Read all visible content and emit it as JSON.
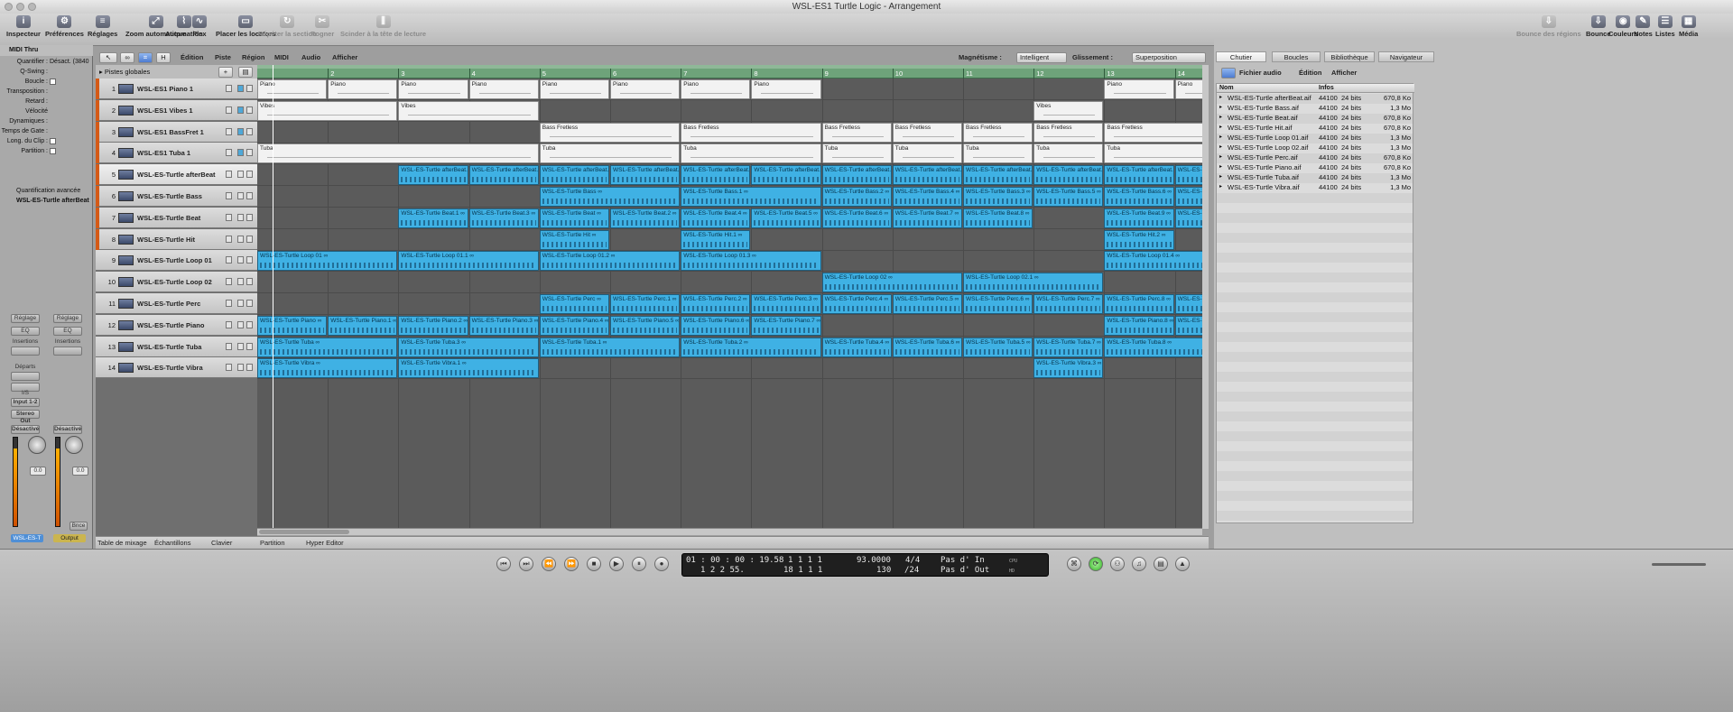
{
  "window": {
    "title": "WSL-ES1 Turtle Logic - Arrangement"
  },
  "toolbar": {
    "left": [
      {
        "label": "Inspecteur",
        "icon": "i"
      },
      {
        "label": "Préférences",
        "icon": "⚙"
      },
      {
        "label": "Réglages",
        "icon": "≡"
      },
      {
        "label": "Zoom automatique",
        "icon": "⤢"
      },
      {
        "label": "Automation",
        "icon": "⌇"
      },
      {
        "label": "Flex",
        "icon": "∿"
      },
      {
        "label": "Placer les locators",
        "icon": "▭"
      },
      {
        "label": "Répéter la section",
        "icon": "↻"
      },
      {
        "label": "Rogner",
        "icon": "✂"
      },
      {
        "label": "Scinder à la tête de lecture",
        "icon": "⫼"
      }
    ],
    "right": [
      {
        "label": "Bounce des régions",
        "icon": "⇩"
      },
      {
        "label": "Bounce",
        "icon": "⇩"
      },
      {
        "label": "Couleurs",
        "icon": "◉"
      },
      {
        "label": "Notes",
        "icon": "✎"
      },
      {
        "label": "Listes",
        "icon": "☰"
      },
      {
        "label": "Média",
        "icon": "▦"
      }
    ]
  },
  "inspector": {
    "header": "MIDI Thru",
    "rows": [
      {
        "label": "Quantifier :",
        "value": "Désact. (3840"
      },
      {
        "label": "Q-Swing :",
        "value": ""
      },
      {
        "label": "Boucle :",
        "value": ""
      },
      {
        "label": "Transposition :",
        "value": ""
      },
      {
        "label": "Retard :",
        "value": ""
      },
      {
        "label": "Vélocité",
        "value": ""
      },
      {
        "label": "Dynamiques :",
        "value": ""
      },
      {
        "label": "Temps de Gate :",
        "value": ""
      },
      {
        "label": "Long. du Clip :",
        "value": ""
      },
      {
        "label": "Partition :",
        "value": ""
      }
    ],
    "advanced": "Quantification avancée",
    "track_section": "WSL-ES-Turtle afterBeat",
    "strip1": {
      "setting": "Réglage",
      "eq": "EQ",
      "inserts": "Insertions",
      "sends": "Départs",
      "io": "I/S",
      "input": "Input 1-2",
      "output": "Stereo Out",
      "auto": "Désactivé",
      "db": "0.0",
      "name": "WSL-ES-T"
    },
    "strip2": {
      "setting": "Réglage",
      "eq": "EQ",
      "inserts": "Insertions",
      "auto": "Désactivé",
      "db": "0.0",
      "bnce": "Bnce",
      "name": "Output"
    }
  },
  "arrange_menu": [
    "Édition",
    "Piste",
    "Région",
    "MIDI",
    "Audio",
    "Afficher"
  ],
  "snap": {
    "label": "Magnétisme :",
    "value": "Intelligent"
  },
  "drag": {
    "label": "Glissement :",
    "value": "Superposition"
  },
  "globals_label": "Pistes globales",
  "ruler": {
    "bars": [
      "2",
      "3",
      "4",
      "5",
      "6",
      "7",
      "8",
      "9",
      "10",
      "11",
      "12",
      "13",
      "14"
    ]
  },
  "tracks": [
    {
      "num": "1",
      "name": "WSL-ES1 Piano 1",
      "kind": "midi"
    },
    {
      "num": "2",
      "name": "WSL-ES1 Vibes 1",
      "kind": "midi"
    },
    {
      "num": "3",
      "name": "WSL-ES1 BassFret 1",
      "kind": "midi"
    },
    {
      "num": "4",
      "name": "WSL-ES1 Tuba 1",
      "kind": "midi"
    },
    {
      "num": "5",
      "name": "WSL-ES-Turtle afterBeat",
      "kind": "audio"
    },
    {
      "num": "6",
      "name": "WSL-ES-Turtle Bass",
      "kind": "audio"
    },
    {
      "num": "7",
      "name": "WSL-ES-Turtle Beat",
      "kind": "audio"
    },
    {
      "num": "8",
      "name": "WSL-ES-Turtle Hit",
      "kind": "audio"
    },
    {
      "num": "9",
      "name": "WSL-ES-Turtle Loop 01",
      "kind": "audio"
    },
    {
      "num": "10",
      "name": "WSL-ES-Turtle Loop 02",
      "kind": "audio"
    },
    {
      "num": "11",
      "name": "WSL-ES-Turtle Perc",
      "kind": "audio"
    },
    {
      "num": "12",
      "name": "WSL-ES-Turtle Piano",
      "kind": "audio"
    },
    {
      "num": "13",
      "name": "WSL-ES-Turtle Tuba",
      "kind": "audio"
    },
    {
      "num": "14",
      "name": "WSL-ES-Turtle Vibra",
      "kind": "audio"
    }
  ],
  "regions": [
    [
      {
        "s": 1,
        "e": 2,
        "t": "Piano"
      },
      {
        "s": 2,
        "e": 3,
        "t": "Piano"
      },
      {
        "s": 3,
        "e": 4,
        "t": "Piano"
      },
      {
        "s": 4,
        "e": 5,
        "t": "Piano"
      },
      {
        "s": 5,
        "e": 6,
        "t": "Piano"
      },
      {
        "s": 6,
        "e": 7,
        "t": "Piano"
      },
      {
        "s": 7,
        "e": 8,
        "t": "Piano"
      },
      {
        "s": 8,
        "e": 9,
        "t": "Piano"
      },
      {
        "s": 13,
        "e": 14,
        "t": "Piano"
      },
      {
        "s": 14,
        "e": 14.6,
        "t": "Piano"
      }
    ],
    [
      {
        "s": 1,
        "e": 3,
        "t": "Vibes"
      },
      {
        "s": 3,
        "e": 5,
        "t": "Vibes"
      },
      {
        "s": 12,
        "e": 13,
        "t": "Vibes"
      }
    ],
    [
      {
        "s": 5,
        "e": 7,
        "t": "Bass Fretless"
      },
      {
        "s": 7,
        "e": 9,
        "t": "Bass Fretless"
      },
      {
        "s": 9,
        "e": 10,
        "t": "Bass Fretless"
      },
      {
        "s": 10,
        "e": 11,
        "t": "Bass Fretless"
      },
      {
        "s": 11,
        "e": 12,
        "t": "Bass Fretless"
      },
      {
        "s": 12,
        "e": 13,
        "t": "Bass Fretless"
      },
      {
        "s": 13,
        "e": 14.6,
        "t": "Bass Fretless"
      }
    ],
    [
      {
        "s": 1,
        "e": 5,
        "t": "Tuba"
      },
      {
        "s": 5,
        "e": 7,
        "t": "Tuba"
      },
      {
        "s": 7,
        "e": 9,
        "t": "Tuba"
      },
      {
        "s": 9,
        "e": 10,
        "t": "Tuba"
      },
      {
        "s": 10,
        "e": 11,
        "t": "Tuba"
      },
      {
        "s": 11,
        "e": 12,
        "t": "Tuba"
      },
      {
        "s": 12,
        "e": 13,
        "t": "Tuba"
      },
      {
        "s": 13,
        "e": 14.6,
        "t": "Tuba"
      }
    ],
    [
      {
        "s": 3,
        "e": 4,
        "t": "WSL-ES-Turtle afterBeat.1"
      },
      {
        "s": 4,
        "e": 5,
        "t": "WSL-ES-Turtle afterBeat.2"
      },
      {
        "s": 5,
        "e": 6,
        "t": "WSL-ES-Turtle afterBeat.3"
      },
      {
        "s": 6,
        "e": 7,
        "t": "WSL-ES-Turtle afterBeat.4"
      },
      {
        "s": 7,
        "e": 8,
        "t": "WSL-ES-Turtle afterBeat.4"
      },
      {
        "s": 8,
        "e": 9,
        "t": "WSL-ES-Turtle afterBeat.5"
      },
      {
        "s": 9,
        "e": 10,
        "t": "WSL-ES-Turtle afterBeat.6"
      },
      {
        "s": 10,
        "e": 11,
        "t": "WSL-ES-Turtle afterBeat.7"
      },
      {
        "s": 11,
        "e": 12,
        "t": "WSL-ES-Turtle afterBeat.8"
      },
      {
        "s": 12,
        "e": 13,
        "t": "WSL-ES-Turtle afterBeat.9"
      },
      {
        "s": 13,
        "e": 14,
        "t": "WSL-ES-Turtle afterBeat.1"
      },
      {
        "s": 14,
        "e": 14.6,
        "t": "WSL-ES-Tu"
      }
    ],
    [
      {
        "s": 5,
        "e": 7,
        "t": "WSL-ES-Turtle Bass ∞"
      },
      {
        "s": 7,
        "e": 9,
        "t": "WSL-ES-Turtle Bass.1 ∞"
      },
      {
        "s": 9,
        "e": 10,
        "t": "WSL-ES-Turtle Bass.2 ∞"
      },
      {
        "s": 10,
        "e": 11,
        "t": "WSL-ES-Turtle Bass.4 ∞"
      },
      {
        "s": 11,
        "e": 12,
        "t": "WSL-ES-Turtle Bass.3 ∞"
      },
      {
        "s": 12,
        "e": 13,
        "t": "WSL-ES-Turtle Bass.5 ∞"
      },
      {
        "s": 13,
        "e": 14,
        "t": "WSL-ES-Turtle Bass.6 ∞"
      },
      {
        "s": 14,
        "e": 14.6,
        "t": "WSL-ES-Tu"
      }
    ],
    [
      {
        "s": 3,
        "e": 4,
        "t": "WSL-ES-Turtle Beat.1 ∞"
      },
      {
        "s": 4,
        "e": 5,
        "t": "WSL-ES-Turtle Beat.3 ∞"
      },
      {
        "s": 5,
        "e": 6,
        "t": "WSL-ES-Turtle Beat ∞"
      },
      {
        "s": 6,
        "e": 7,
        "t": "WSL-ES-Turtle Beat.2 ∞"
      },
      {
        "s": 7,
        "e": 8,
        "t": "WSL-ES-Turtle Beat.4 ∞"
      },
      {
        "s": 8,
        "e": 9,
        "t": "WSL-ES-Turtle Beat.5 ∞"
      },
      {
        "s": 9,
        "e": 10,
        "t": "WSL-ES-Turtle Beat.6 ∞"
      },
      {
        "s": 10,
        "e": 11,
        "t": "WSL-ES-Turtle Beat.7 ∞"
      },
      {
        "s": 11,
        "e": 12,
        "t": "WSL-ES-Turtle Beat.8 ∞"
      },
      {
        "s": 13,
        "e": 14,
        "t": "WSL-ES-Turtle Beat.9 ∞"
      },
      {
        "s": 14,
        "e": 14.6,
        "t": "WSL-ES-Tu"
      }
    ],
    [
      {
        "s": 5,
        "e": 6,
        "t": "WSL-ES-Turtle Hit ∞"
      },
      {
        "s": 7,
        "e": 8,
        "t": "WSL-ES-Turtle Hit.1 ∞"
      },
      {
        "s": 13,
        "e": 14,
        "t": "WSL-ES-Turtle Hit.2 ∞"
      }
    ],
    [
      {
        "s": 1,
        "e": 3,
        "t": "WSL-ES-Turtle Loop 01 ∞"
      },
      {
        "s": 3,
        "e": 5,
        "t": "WSL-ES-Turtle Loop 01.1 ∞"
      },
      {
        "s": 5,
        "e": 7,
        "t": "WSL-ES-Turtle Loop 01.2 ∞"
      },
      {
        "s": 7,
        "e": 9,
        "t": "WSL-ES-Turtle Loop 01.3 ∞"
      },
      {
        "s": 13,
        "e": 14.6,
        "t": "WSL-ES-Turtle Loop 01.4 ∞"
      }
    ],
    [
      {
        "s": 9,
        "e": 11,
        "t": "WSL-ES-Turtle Loop 02 ∞"
      },
      {
        "s": 11,
        "e": 13,
        "t": "WSL-ES-Turtle Loop 02.1 ∞"
      }
    ],
    [
      {
        "s": 5,
        "e": 6,
        "t": "WSL-ES-Turtle Perc ∞"
      },
      {
        "s": 6,
        "e": 7,
        "t": "WSL-ES-Turtle Perc.1 ∞"
      },
      {
        "s": 7,
        "e": 8,
        "t": "WSL-ES-Turtle Perc.2 ∞"
      },
      {
        "s": 8,
        "e": 9,
        "t": "WSL-ES-Turtle Perc.3 ∞"
      },
      {
        "s": 9,
        "e": 10,
        "t": "WSL-ES-Turtle Perc.4 ∞"
      },
      {
        "s": 10,
        "e": 11,
        "t": "WSL-ES-Turtle Perc.5 ∞"
      },
      {
        "s": 11,
        "e": 12,
        "t": "WSL-ES-Turtle Perc.6 ∞"
      },
      {
        "s": 12,
        "e": 13,
        "t": "WSL-ES-Turtle Perc.7 ∞"
      },
      {
        "s": 13,
        "e": 14,
        "t": "WSL-ES-Turtle Perc.8 ∞"
      },
      {
        "s": 14,
        "e": 14.6,
        "t": "WSL-ES-Tu"
      }
    ],
    [
      {
        "s": 1,
        "e": 2,
        "t": "WSL-ES-Turtle Piano ∞"
      },
      {
        "s": 2,
        "e": 3,
        "t": "WSL-ES-Turtle Piano.1 ∞"
      },
      {
        "s": 3,
        "e": 4,
        "t": "WSL-ES-Turtle Piano.2 ∞"
      },
      {
        "s": 4,
        "e": 5,
        "t": "WSL-ES-Turtle Piano.3 ∞"
      },
      {
        "s": 5,
        "e": 6,
        "t": "WSL-ES-Turtle Piano.4 ∞"
      },
      {
        "s": 6,
        "e": 7,
        "t": "WSL-ES-Turtle Piano.5 ∞"
      },
      {
        "s": 7,
        "e": 8,
        "t": "WSL-ES-Turtle Piano.6 ∞"
      },
      {
        "s": 8,
        "e": 9,
        "t": "WSL-ES-Turtle Piano.7 ∞"
      },
      {
        "s": 13,
        "e": 14,
        "t": "WSL-ES-Turtle Piano.8 ∞"
      },
      {
        "s": 14,
        "e": 14.6,
        "t": "WSL-ES-Tu"
      }
    ],
    [
      {
        "s": 1,
        "e": 3,
        "t": "WSL-ES-Turtle Tuba ∞"
      },
      {
        "s": 3,
        "e": 5,
        "t": "WSL-ES-Turtle Tuba.3 ∞"
      },
      {
        "s": 5,
        "e": 7,
        "t": "WSL-ES-Turtle Tuba.1 ∞"
      },
      {
        "s": 7,
        "e": 9,
        "t": "WSL-ES-Turtle Tuba.2 ∞"
      },
      {
        "s": 9,
        "e": 10,
        "t": "WSL-ES-Turtle Tuba.4 ∞"
      },
      {
        "s": 10,
        "e": 11,
        "t": "WSL-ES-Turtle Tuba.6 ∞"
      },
      {
        "s": 11,
        "e": 12,
        "t": "WSL-ES-Turtle Tuba.5 ∞"
      },
      {
        "s": 12,
        "e": 13,
        "t": "WSL-ES-Turtle Tuba.7 ∞"
      },
      {
        "s": 13,
        "e": 14.6,
        "t": "WSL-ES-Turtle Tuba.8 ∞"
      }
    ],
    [
      {
        "s": 1,
        "e": 3,
        "t": "WSL-ES-Turtle Vibra ∞"
      },
      {
        "s": 3,
        "e": 5,
        "t": "WSL-ES-Turtle Vibra.1 ∞"
      },
      {
        "s": 12,
        "e": 13,
        "t": "WSL-ES-Turtle Vibra.3 ∞"
      }
    ]
  ],
  "bottom_tabs": [
    "Table de mixage",
    "Échantillons",
    "Clavier",
    "Partition",
    "Hyper Editor"
  ],
  "right_panel": {
    "tabs": [
      "Chutier",
      "Boucles",
      "Bibliothèque",
      "Navigateur"
    ],
    "menus": [
      "Fichier audio",
      "Édition",
      "Afficher"
    ],
    "columns": {
      "name": "Nom",
      "info": "Infos"
    },
    "files": [
      {
        "name": "WSL-ES-Turtle afterBeat.aif",
        "rate": "44100",
        "bits": "24 bits",
        "size": "670,8 Ko"
      },
      {
        "name": "WSL-ES-Turtle Bass.aif",
        "rate": "44100",
        "bits": "24 bits",
        "size": "1,3 Mo"
      },
      {
        "name": "WSL-ES-Turtle Beat.aif",
        "rate": "44100",
        "bits": "24 bits",
        "size": "670,8 Ko"
      },
      {
        "name": "WSL-ES-Turtle Hit.aif",
        "rate": "44100",
        "bits": "24 bits",
        "size": "670,8 Ko"
      },
      {
        "name": "WSL-ES-Turtle Loop 01.aif",
        "rate": "44100",
        "bits": "24 bits",
        "size": "1,3 Mo"
      },
      {
        "name": "WSL-ES-Turtle Loop 02.aif",
        "rate": "44100",
        "bits": "24 bits",
        "size": "1,3 Mo"
      },
      {
        "name": "WSL-ES-Turtle Perc.aif",
        "rate": "44100",
        "bits": "24 bits",
        "size": "670,8 Ko"
      },
      {
        "name": "WSL-ES-Turtle Piano.aif",
        "rate": "44100",
        "bits": "24 bits",
        "size": "670,8 Ko"
      },
      {
        "name": "WSL-ES-Turtle Tuba.aif",
        "rate": "44100",
        "bits": "24 bits",
        "size": "1,3 Mo"
      },
      {
        "name": "WSL-ES-Turtle Vibra.aif",
        "rate": "44100",
        "bits": "24 bits",
        "size": "1,3 Mo"
      }
    ]
  },
  "transport": {
    "smpte": "01 : 00 : 00 : 19.58",
    "bars": "1   2   2   55.",
    "pos1": "1   1   1   1",
    "pos2": "18   1   1   1",
    "tempo": "93.0000",
    "tempo2": "130",
    "sig": "4/4",
    "div": "/24",
    "in": "Pas d' In",
    "out": "Pas d' Out",
    "cpu": "CPU",
    "hd": "HD"
  }
}
